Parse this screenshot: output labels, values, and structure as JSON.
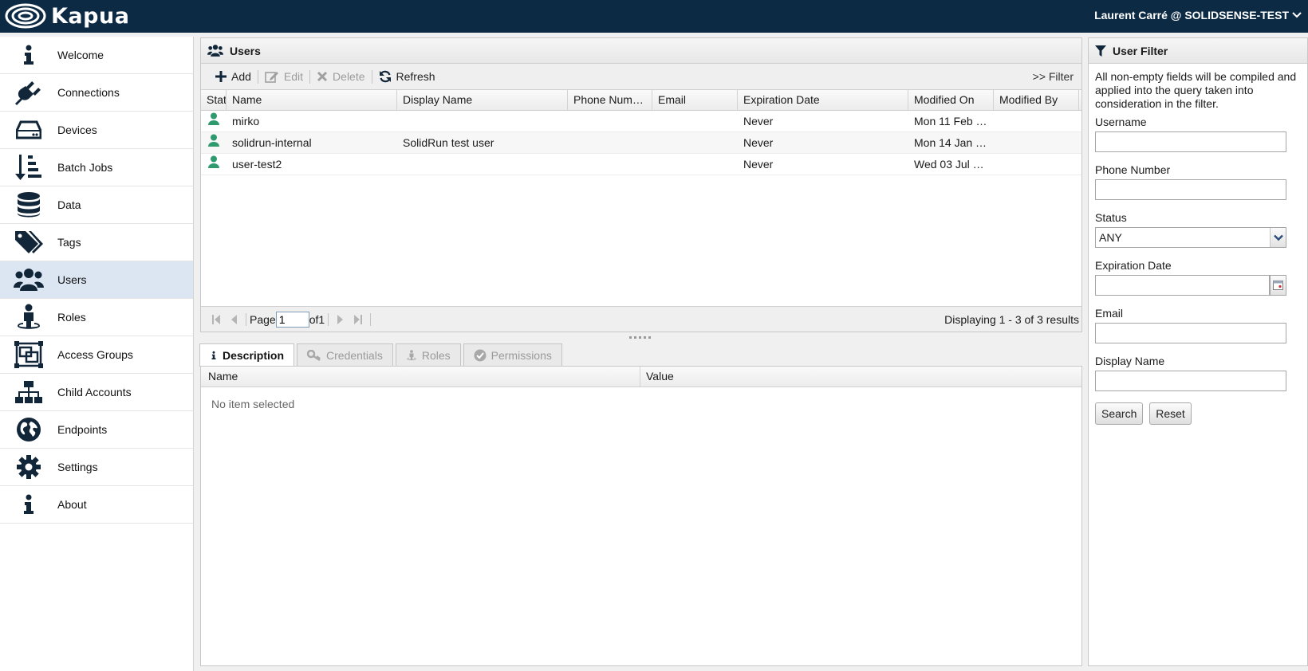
{
  "header": {
    "brand": "Kapua",
    "user_label": "Laurent Carré @ SOLIDSENSE-TEST"
  },
  "sidebar": {
    "items": [
      {
        "label": "Welcome",
        "icon": "info-icon"
      },
      {
        "label": "Connections",
        "icon": "plug-icon"
      },
      {
        "label": "Devices",
        "icon": "hdd-icon"
      },
      {
        "label": "Batch Jobs",
        "icon": "sort-amount-icon"
      },
      {
        "label": "Data",
        "icon": "database-icon"
      },
      {
        "label": "Tags",
        "icon": "tags-icon"
      },
      {
        "label": "Users",
        "icon": "users-icon",
        "active": true
      },
      {
        "label": "Roles",
        "icon": "street-view-icon"
      },
      {
        "label": "Access Groups",
        "icon": "object-group-icon"
      },
      {
        "label": "Child Accounts",
        "icon": "sitemap-icon"
      },
      {
        "label": "Endpoints",
        "icon": "globe-icon"
      },
      {
        "label": "Settings",
        "icon": "gear-icon"
      },
      {
        "label": "About",
        "icon": "info-icon"
      }
    ]
  },
  "users_panel": {
    "title": "Users",
    "toolbar": {
      "add": "Add",
      "edit": "Edit",
      "delete": "Delete",
      "refresh": "Refresh",
      "filter": ">> Filter"
    },
    "columns": [
      "Stat",
      "Name",
      "Display Name",
      "Phone Num…",
      "Email",
      "Expiration Date",
      "Modified On",
      "Modified By"
    ],
    "rows": [
      {
        "name": "mirko",
        "display_name": "",
        "phone": "",
        "email": "",
        "expiration": "Never",
        "modified_on": "Mon 11 Feb …",
        "modified_by": ""
      },
      {
        "name": "solidrun-internal",
        "display_name": "SolidRun test user",
        "phone": "",
        "email": "",
        "expiration": "Never",
        "modified_on": "Mon 14 Jan …",
        "modified_by": ""
      },
      {
        "name": "user-test2",
        "display_name": "",
        "phone": "",
        "email": "",
        "expiration": "Never",
        "modified_on": "Wed 03 Jul …",
        "modified_by": ""
      }
    ],
    "pager": {
      "page_label": "Page",
      "page_value": "1",
      "of_label": "of1",
      "summary": "Displaying 1 - 3 of 3 results"
    }
  },
  "detail": {
    "tabs": [
      "Description",
      "Credentials",
      "Roles",
      "Permissions"
    ],
    "columns": [
      "Name",
      "Value"
    ],
    "empty": "No item selected"
  },
  "filter": {
    "title": "User Filter",
    "hint": "All non-empty fields will be compiled and applied into the query taken into consideration in the filter.",
    "username_label": "Username",
    "phone_label": "Phone Number",
    "status_label": "Status",
    "status_value": "ANY",
    "expiration_label": "Expiration Date",
    "email_label": "Email",
    "display_name_label": "Display Name",
    "search": "Search",
    "reset": "Reset"
  },
  "colors": {
    "header_bg": "#0c2a44",
    "icon_dark": "#12263a",
    "active_nav": "#dce6f3",
    "user_status_green": "#2e9a6e"
  }
}
